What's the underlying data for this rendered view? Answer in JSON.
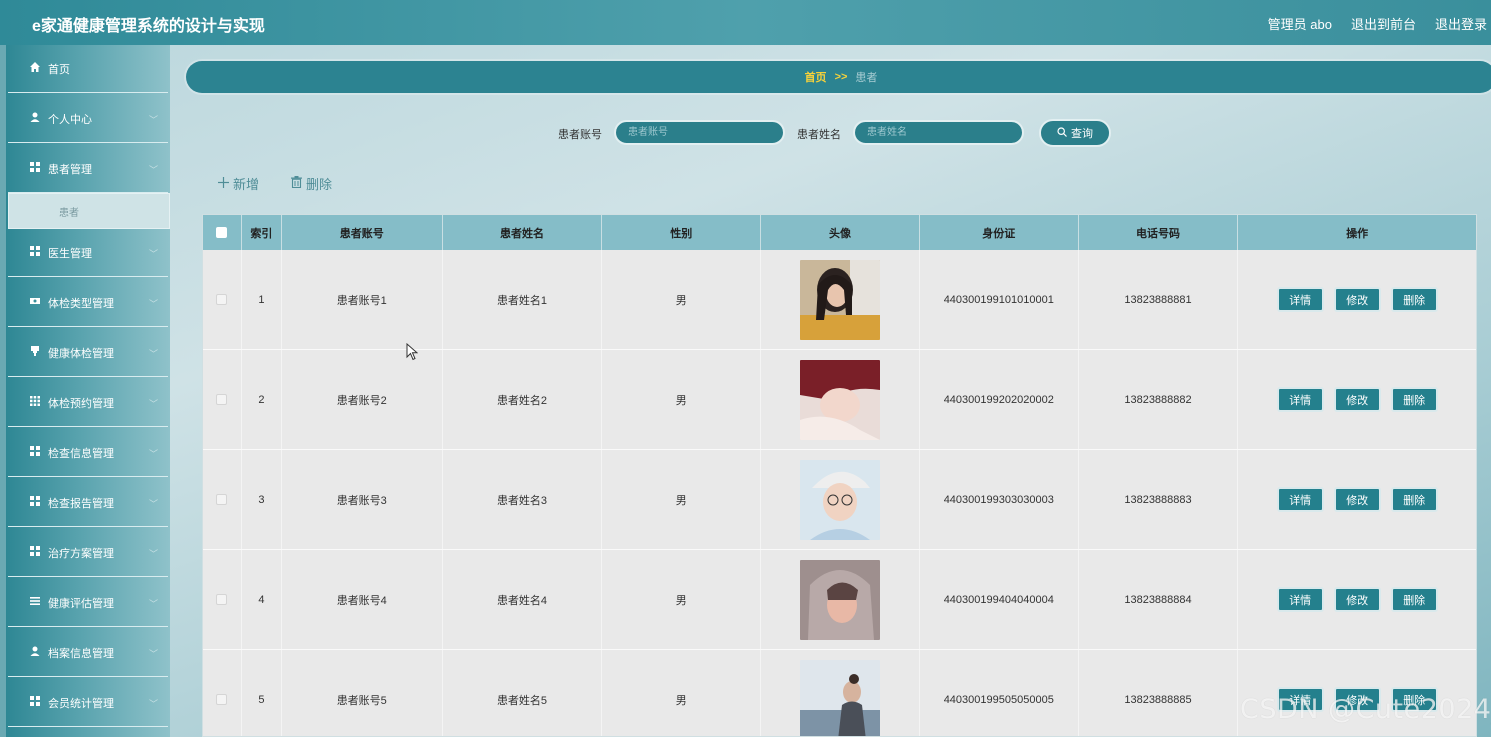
{
  "header": {
    "title": "e家通健康管理系统的设计与实现",
    "user_prefix": "管理员",
    "username": "abo",
    "back_to_front": "退出到前台",
    "logout": "退出登录"
  },
  "sidebar": {
    "items": [
      {
        "label": "首页",
        "icon": "home-icon"
      },
      {
        "label": "个人中心",
        "icon": "user-icon"
      },
      {
        "label": "患者管理",
        "icon": "grid-icon"
      },
      {
        "label": "医生管理",
        "icon": "grid-icon"
      },
      {
        "label": "体检类型管理",
        "icon": "ticket-icon"
      },
      {
        "label": "健康体检管理",
        "icon": "clipboard-icon"
      },
      {
        "label": "体检预约管理",
        "icon": "apps-icon"
      },
      {
        "label": "检查信息管理",
        "icon": "grid-icon"
      },
      {
        "label": "检查报告管理",
        "icon": "grid-icon"
      },
      {
        "label": "治疗方案管理",
        "icon": "grid-icon"
      },
      {
        "label": "健康评估管理",
        "icon": "list-icon"
      },
      {
        "label": "档案信息管理",
        "icon": "user-icon"
      },
      {
        "label": "会员统计管理",
        "icon": "grid-icon"
      }
    ],
    "active_sub": "患者"
  },
  "breadcrumb": {
    "home": "首页",
    "separator": ">>",
    "current": "患者"
  },
  "search": {
    "account_label": "患者账号",
    "account_placeholder": "患者账号",
    "name_label": "患者姓名",
    "name_placeholder": "患者姓名",
    "query_label": "查询"
  },
  "actions": {
    "add_label": "新增",
    "delete_label": "删除"
  },
  "table": {
    "columns": [
      "索引",
      "患者账号",
      "患者姓名",
      "性别",
      "头像",
      "身份证",
      "电话号码",
      "操作"
    ],
    "rows": [
      {
        "index": "1",
        "account": "患者账号1",
        "name": "患者姓名1",
        "gender": "男",
        "id_card": "440300199101010001",
        "phone": "13823888881"
      },
      {
        "index": "2",
        "account": "患者账号2",
        "name": "患者姓名2",
        "gender": "男",
        "id_card": "440300199202020002",
        "phone": "13823888882"
      },
      {
        "index": "3",
        "account": "患者账号3",
        "name": "患者姓名3",
        "gender": "男",
        "id_card": "440300199303030003",
        "phone": "13823888883"
      },
      {
        "index": "4",
        "account": "患者账号4",
        "name": "患者姓名4",
        "gender": "男",
        "id_card": "440300199404040004",
        "phone": "13823888884"
      },
      {
        "index": "5",
        "account": "患者账号5",
        "name": "患者姓名5",
        "gender": "男",
        "id_card": "440300199505050005",
        "phone": "13823888885"
      }
    ],
    "row_buttons": {
      "detail": "详情",
      "edit": "修改",
      "delete": "删除"
    }
  },
  "watermark": "CSDN @Cute2024_",
  "colors": {
    "accent": "#2c8391",
    "breadcrumb_home": "#f6d23a",
    "header_row": "#85bdc8"
  }
}
